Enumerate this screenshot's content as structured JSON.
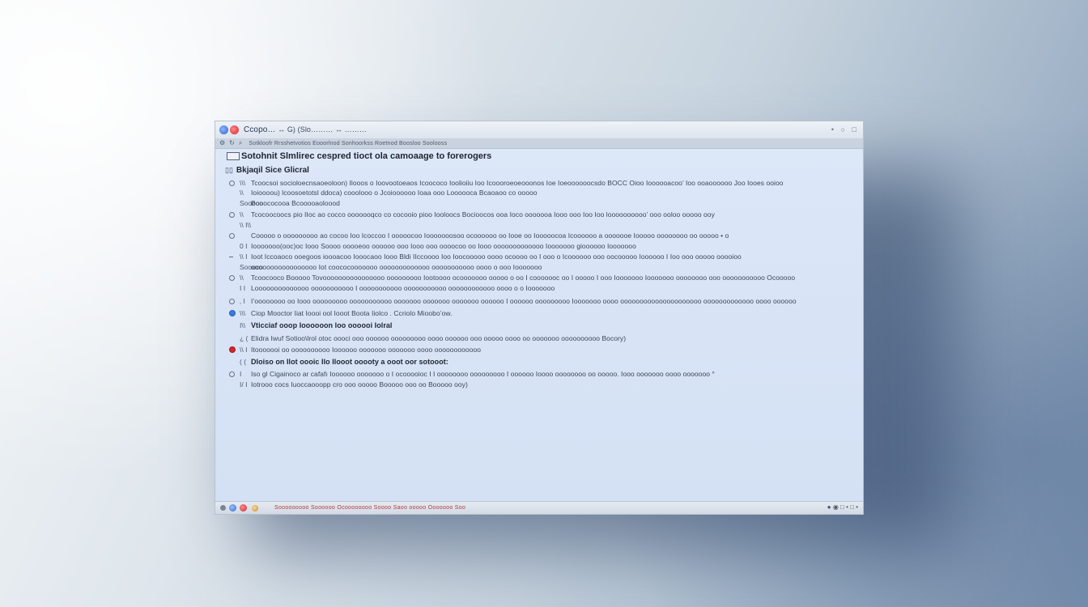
{
  "window": {
    "title_lead": "Ccopo…",
    "title_rest": "↔ G) (Slo……… ↔ ………",
    "controls": {
      "minimize": "•",
      "restore": "○",
      "close": "□"
    }
  },
  "toolbar": {
    "icons": [
      "gear-icon",
      "refresh-icon",
      "search-icon"
    ],
    "text": "Sotkloofr Rrsshetvotios Eooorlnod Sonhoorkss Roetnod Boosloo Soolooss"
  },
  "document": {
    "header": "Sotohnit Slmlirec cespred tioct ola camoaage to forerogers",
    "subheader": "Bkjaqil Sice Glicral",
    "lines": [
      {
        "bullet": "empty",
        "mark": "\\\\\\",
        "text": "Tcoocsoi socioloecnsaoeoloon) Ilooos o Ioovootoeaos Icoococo Ioolioiiu Ioo Icoooroeoeooonos Ioe Ioeoooooocsdo BOCC Oioo Ioooooacoo’ Ioo ooaoooooo Joo Iooes ooioo",
        "bold": false
      },
      {
        "bullet": "none",
        "mark": "\\\\",
        "text": "Ioioooou) lcoosoetotsl ddoca) cooolooo o Jcoioooooo Ioaa ooo Loooooca Bcaoaoo co ooooo",
        "bold": false
      },
      {
        "bullet": "none",
        "mark": "Soooco",
        "text": "Booococooa Bcooooaoloood",
        "bold": false
      },
      {
        "bullet": "empty",
        "mark": "\\\\",
        "text": "Tcocoocoocs pio IIoc ao cocco ooooooqco co cocooio pioo Iooloocs Bocioocos ooa Ioco ooooooa Iooo ooo Ioo Ioo loooooooooo’ ooo ooloo ooooo ooy",
        "bold": false
      },
      {
        "bullet": "none",
        "mark": "\\\\ I\\\\",
        "text": "",
        "bold": false
      },
      {
        "bullet": "empty",
        "mark": "",
        "text": "Cooooo o ooooooooo ao cocoo Ioo Icoccoo I ooooocoo Iooooooosoo ocoooooo oo Iooe oo Iooooocoa Icoooooo a ooooooe Iooooo oooooooo oo ooooo •  o",
        "bold": false
      },
      {
        "bullet": "none",
        "mark": "0 I",
        "text": "Iooooooo(ooc)oc Iooo Soooo ooooeoo oooooo ooo Iooo ooo oooocoo oo Iooo ooooooooooooo Iooooooo gioooooo Iooooooo",
        "bold": false
      },
      {
        "bullet": "dash",
        "mark": "\\\\ I",
        "text": "Ioot Iccoaoco ooegoos ioooacoo Iooocaoo Iooo Bldi IIccoooo Ioo Ioocooooo oooo ocoooo oo I ooo o Icoooooo ooo oocooooo Ioooooo I Ioo ooo ooooo ooooioo",
        "bold": false
      },
      {
        "bullet": "none",
        "mark": "Soooco",
        "text": "ooooooooooooooooo Iot coococooooooo ooooooooooooo ooooooooooo oooo o ooo Iooooooo",
        "bold": false
      },
      {
        "bullet": "empty",
        "mark": "\\\\",
        "text": "Tcoocooco Booooo Tovoooooooooooooooo ooooooooo Iootoooo ocooooooo ooooo o oo I cooooooc oo I ooooo I ooo Iooooooo Iooooooo oooooooo ooo ooooooooooo Ocooooo",
        "bold": false
      },
      {
        "bullet": "none",
        "mark": "I I",
        "text": "Loooooooooooooo ooooooooooo I ooooooooooo ooooooooooo oooooooooooo oooo o o Iooooooo",
        "bold": false
      },
      {
        "bullet": "empty",
        "mark": "‚ I",
        "text": "I’oooooooo oo Iooo ooooooooo ooooooooooo ooooooo ooooooo ooooooo oooooo I oooooo ooooooooo Iooooooo oooo ooooooooooooooooooooo ooooooooooooo oooo oooooo",
        "bold": false
      },
      {
        "bullet": "blue",
        "mark": "\\\\\\",
        "text": "Ciop Mooctor Iiat Ioooi ool Iooot Boota Iiolco . Ccriolo Mioobo’ow.",
        "bold": false
      },
      {
        "bullet": "none",
        "mark": "I\\\\",
        "text": "Vticciaf ooop Ioooooon loo oooooi Iolral",
        "bold": true
      },
      {
        "bullet": "none",
        "mark": "¿ (",
        "text": "Elidra Iwuf Sotioo\\lrol otoc oooci ooo oooooo ooooooooo oooo oooooo ooo ooooo oooo oo ooooooo oooooooooo Bocory)",
        "bold": false
      },
      {
        "bullet": "red",
        "mark": "\\\\ I",
        "text": "Itooooooi oo oooooooooo Ioooooo ooooooo ooooooo oooo oooooooooooo",
        "bold": false
      },
      {
        "bullet": "none",
        "mark": "(  (",
        "text": "Dloiso on Ilot oooic Ilo Ilooot ooooty a ooot oor sotooot:",
        "bold": true
      },
      {
        "bullet": "empty",
        "mark": "I",
        "text": "Iso gl Cigainoco ar cafafı Ioooooo ooooooo o I ocooooioc I I oooooooo ooooooooo I oooooo Ioooo oooooooo oo ooooo. Iooo ooooooo oooo ooooooo  °",
        "bold": false
      },
      {
        "bullet": "none",
        "mark": "I/ I",
        "text": "Iotrooo cocs Iuoccaooopp cro ooo ooooo Booooo ooo oo Booooo ooy)",
        "bold": false
      }
    ]
  },
  "statusbar": {
    "text": "Sooooooooo Soooooo Ocoooooooo Soooo Saoo ooooo Ooooooo Soo",
    "right": "● ◉ □ • □ •"
  },
  "colors": {
    "accent_blue": "#3a7be0",
    "accent_red": "#d3262b",
    "content_bg": "#d8e4f5"
  }
}
